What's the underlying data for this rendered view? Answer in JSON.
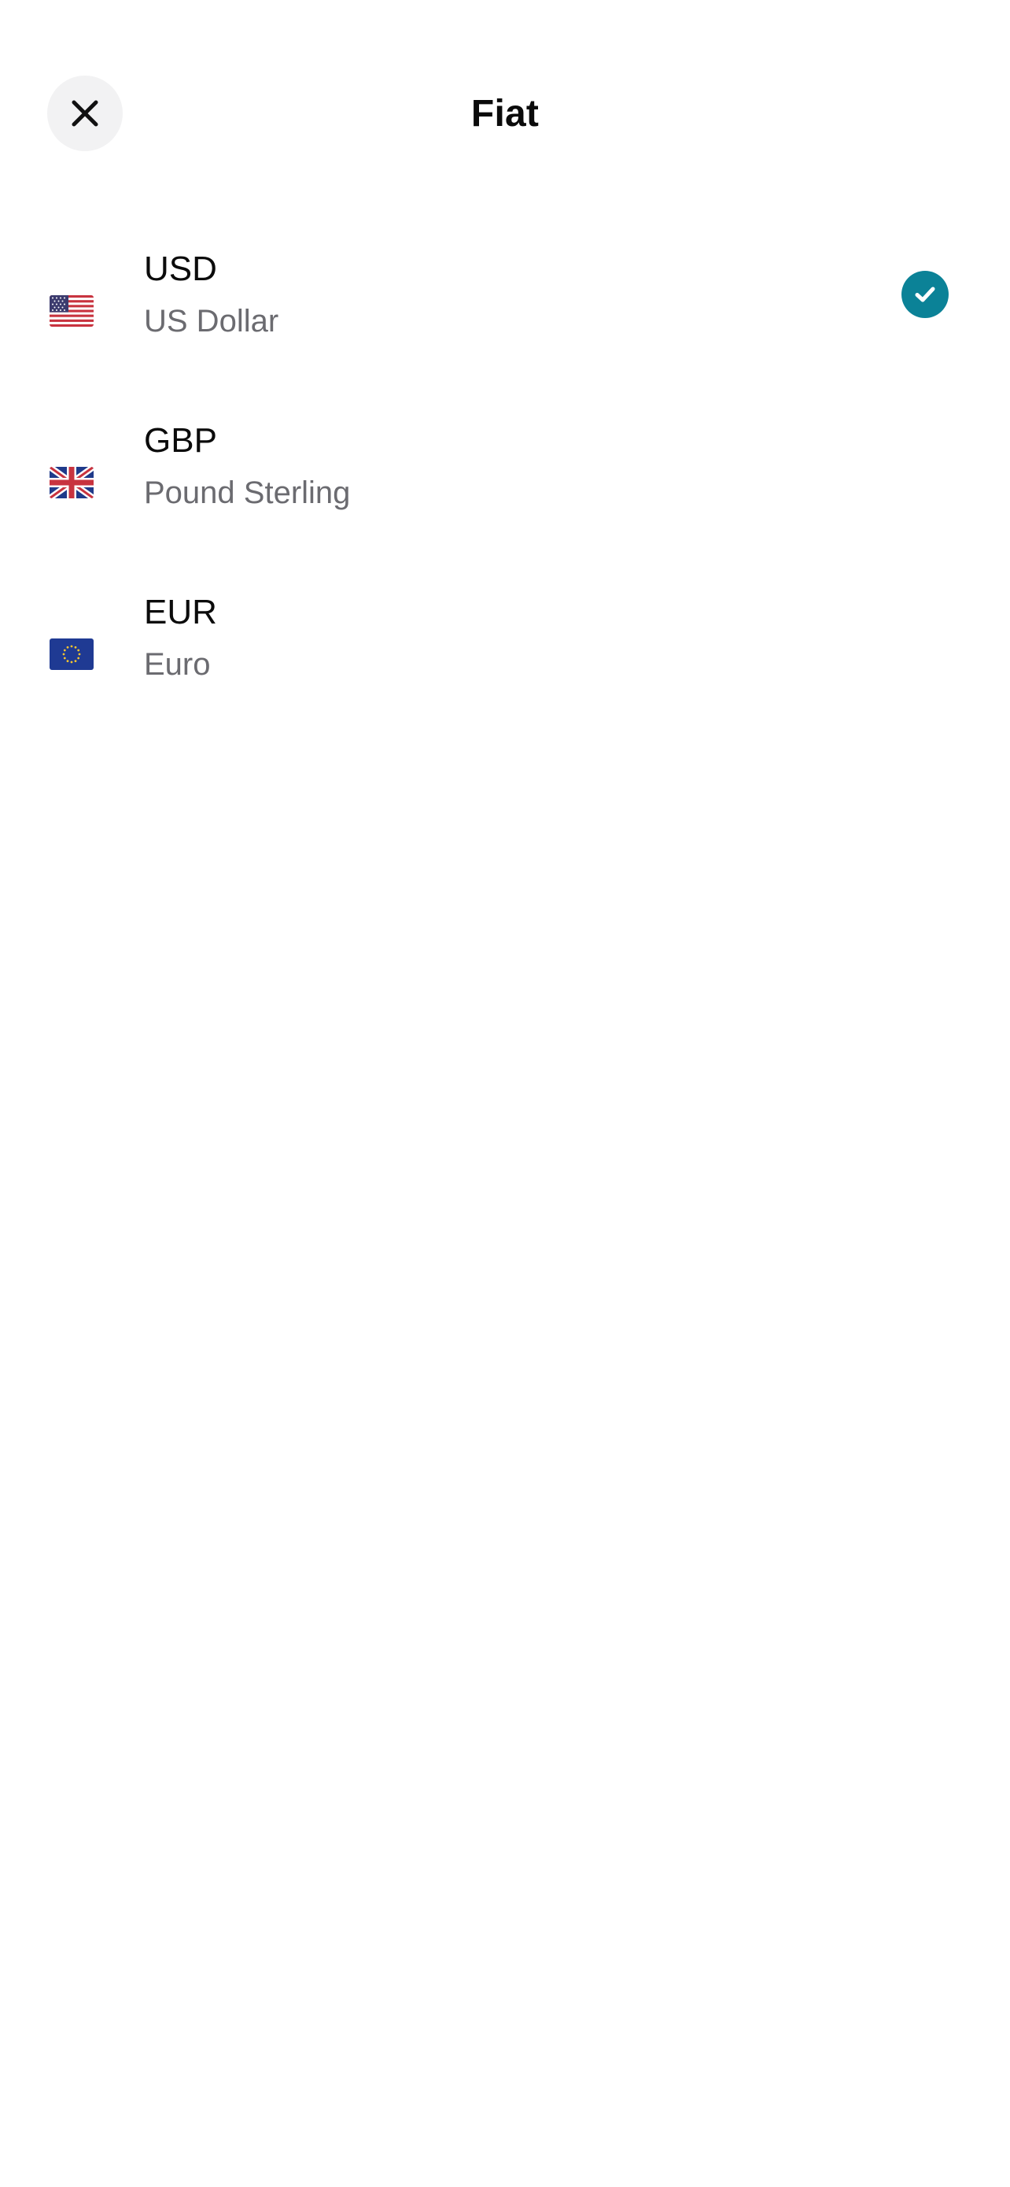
{
  "header": {
    "title": "Fiat",
    "close_icon": "close-icon"
  },
  "currencies": [
    {
      "code": "USD",
      "name": "US Dollar",
      "flag_icon": "us-flag-icon",
      "selected": true
    },
    {
      "code": "GBP",
      "name": "Pound Sterling",
      "flag_icon": "uk-flag-icon",
      "selected": false
    },
    {
      "code": "EUR",
      "name": "Euro",
      "flag_icon": "eu-flag-icon",
      "selected": false
    }
  ],
  "colors": {
    "accent": "#0b8297",
    "close_button_bg": "#f2f2f3",
    "primary_text": "#0b0b0b",
    "secondary_text": "#6b6b70"
  }
}
